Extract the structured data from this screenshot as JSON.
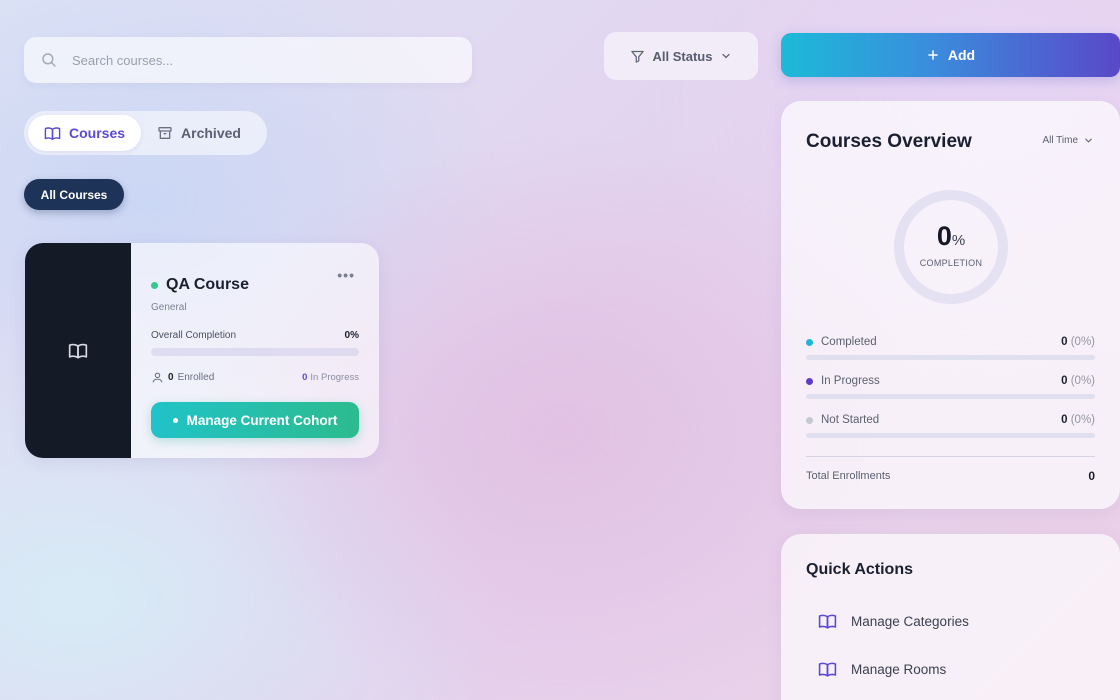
{
  "search": {
    "placeholder": "Search courses..."
  },
  "filter": {
    "status_label": "All Status"
  },
  "actions": {
    "add_label": "Add"
  },
  "tabs": [
    {
      "label": "Courses",
      "icon": "book-icon",
      "active": true
    },
    {
      "label": "Archived",
      "icon": "archive-icon",
      "active": false
    }
  ],
  "category_chip": {
    "label": "All Courses"
  },
  "course": {
    "title": "QA Course",
    "category": "General",
    "completion_label": "Overall Completion",
    "completion_value": "0%",
    "completion_fraction": 0,
    "enrolled_count": "0",
    "enrolled_label": "Enrolled",
    "in_progress_count": "0",
    "in_progress_label": "In Progress",
    "manage_label": "Manage Current Cohort",
    "status_color": "#35c98f"
  },
  "overview": {
    "title": "Courses Overview",
    "time_filter": "All Time",
    "completion_value": "0",
    "completion_unit": "%",
    "completion_caption": "COMPLETION",
    "stats": [
      {
        "label": "Completed",
        "count": "0",
        "pct": "(0%)",
        "color": "#1fb5d6"
      },
      {
        "label": "In Progress",
        "count": "0",
        "pct": "(0%)",
        "color": "#5a3fc4"
      },
      {
        "label": "Not Started",
        "count": "0",
        "pct": "(0%)",
        "color": "#c4c8d2"
      }
    ],
    "total_label": "Total Enrollments",
    "total_value": "0"
  },
  "quick_actions": {
    "title": "Quick Actions",
    "items": [
      {
        "label": "Manage Categories",
        "icon": "book-icon"
      },
      {
        "label": "Manage Rooms",
        "icon": "book-icon"
      }
    ]
  },
  "colors": {
    "accent": "#5a4ad1",
    "navy": "#1e3358",
    "teal": "#20c3c8"
  }
}
